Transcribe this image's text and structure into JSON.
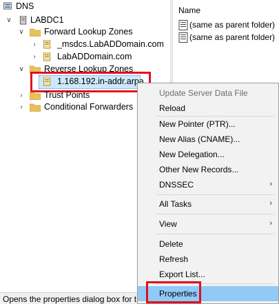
{
  "tree": {
    "root": "DNS",
    "server": "LABDC1",
    "forward_zones": "Forward Lookup Zones",
    "fz_items": [
      "_msdcs.LabADDomain.com",
      "LabADDomain.com"
    ],
    "reverse_zones": "Reverse Lookup Zones",
    "rz_item": "1.168.192.in-addr.arpa",
    "trust_points": "Trust Points",
    "conditional_forwarders": "Conditional Forwarders"
  },
  "list": {
    "column_name": "Name",
    "rows": [
      "(same as parent folder)",
      "(same as parent folder)"
    ]
  },
  "menu": {
    "update_server_data_file": "Update Server Data File",
    "reload": "Reload",
    "new_pointer": "New Pointer (PTR)...",
    "new_alias": "New Alias (CNAME)...",
    "new_delegation": "New Delegation...",
    "other_new_records": "Other New Records...",
    "dnssec": "DNSSEC",
    "all_tasks": "All Tasks",
    "view": "View",
    "delete": "Delete",
    "refresh": "Refresh",
    "export_list": "Export List...",
    "properties": "Properties"
  },
  "status": "Opens the properties dialog box for t",
  "colors": {
    "highlight": "#91c9f7",
    "callout": "#e0101e",
    "folder": "#e8c15a"
  }
}
